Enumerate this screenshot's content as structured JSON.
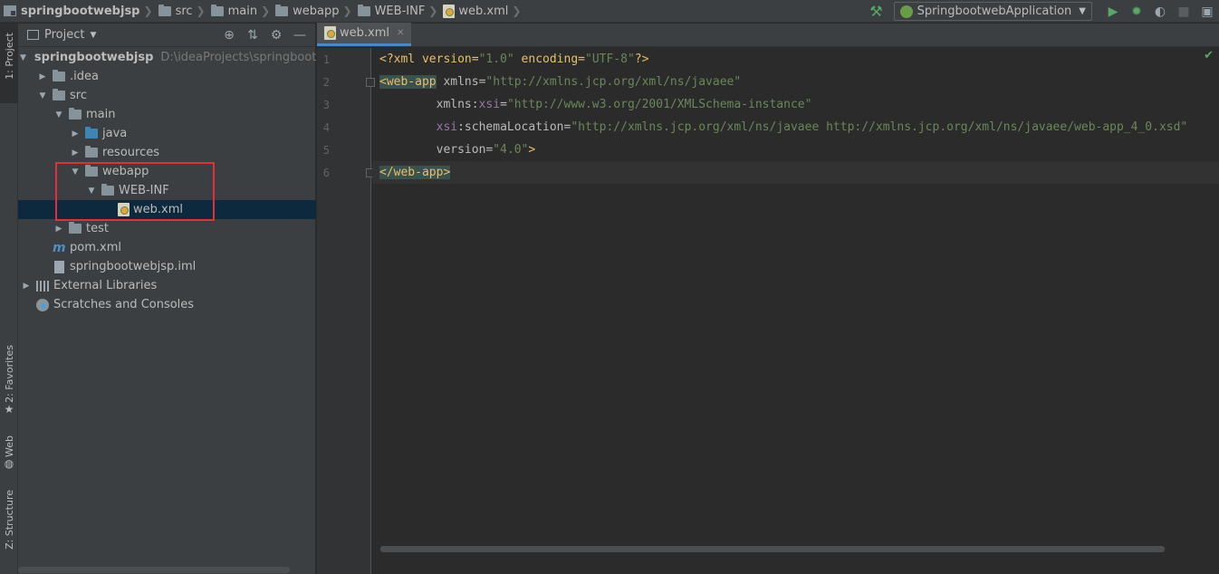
{
  "breadcrumb": [
    {
      "label": "springbootwebjsp",
      "icon": "module-icon"
    },
    {
      "label": "src",
      "icon": "folder-icon"
    },
    {
      "label": "main",
      "icon": "folder-icon"
    },
    {
      "label": "webapp",
      "icon": "folder-icon"
    },
    {
      "label": "WEB-INF",
      "icon": "folder-icon"
    },
    {
      "label": "web.xml",
      "icon": "xml-file-icon"
    }
  ],
  "toolbar": {
    "run_config": "SpringbootwebApplication"
  },
  "left_strip": {
    "project_tab": "1: Project",
    "favorites_tab": "2: Favorites",
    "web_tab": "Web",
    "structure_tab": "Z: Structure"
  },
  "project_panel": {
    "title": "Project",
    "tree": [
      {
        "label": "springbootwebjsp",
        "path": "D:\\ideaProjects\\springbootwe",
        "expanded": true
      },
      {
        "label": ".idea",
        "expanded": false
      },
      {
        "label": "src",
        "expanded": true
      },
      {
        "label": "main",
        "expanded": true
      },
      {
        "label": "java",
        "expanded": false
      },
      {
        "label": "resources",
        "expanded": false
      },
      {
        "label": "webapp",
        "expanded": true
      },
      {
        "label": "WEB-INF",
        "expanded": true
      },
      {
        "label": "web.xml",
        "selected": true
      },
      {
        "label": "test",
        "expanded": false
      },
      {
        "label": "pom.xml"
      },
      {
        "label": "springbootwebjsp.iml"
      },
      {
        "label": "External Libraries",
        "expanded": false
      },
      {
        "label": "Scratches and Consoles"
      }
    ]
  },
  "editor": {
    "tab_label": "web.xml",
    "line_numbers": [
      "1",
      "2",
      "3",
      "4",
      "5",
      "6"
    ],
    "lines": {
      "l1_open": "<?xml version=",
      "l1_v1": "\"1.0\"",
      "l1_mid": " encoding=",
      "l1_v2": "\"UTF-8\"",
      "l1_end": "?>",
      "l2_tag": "<web-app",
      "l2_attr": " xmlns=",
      "l2_val": "\"http://xmlns.jcp.org/xml/ns/javaee\"",
      "l3_indent": "        xmlns:",
      "l3_ns": "xsi",
      "l3_eq": "=",
      "l3_val": "\"http://www.w3.org/2001/XMLSchema-instance\"",
      "l4_indent": "        ",
      "l4_ns": "xsi",
      "l4_attr": ":schemaLocation=",
      "l4_val": "\"http://xmlns.jcp.org/xml/ns/javaee http://xmlns.jcp.org/xml/ns/javaee/web-app_4_0.xsd\"",
      "l5_indent": "        version=",
      "l5_val": "\"4.0\"",
      "l5_end": ">",
      "l6_tag": "</web-app>"
    }
  },
  "colors": {
    "highlight_box": "#e0303a",
    "selection": "#0d293e",
    "tab_underline": "#4a88c7"
  }
}
